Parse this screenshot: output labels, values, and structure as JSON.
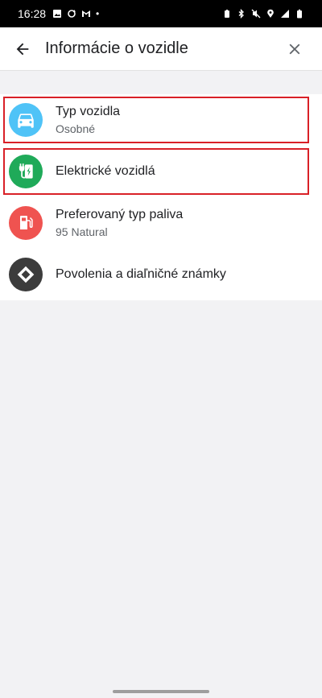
{
  "status_bar": {
    "time": "16:28",
    "dot": "•"
  },
  "app_bar": {
    "title": "Informácie o vozidle",
    "back_icon": "arrow-left-icon",
    "close_icon": "close-icon"
  },
  "items": [
    {
      "label": "Typ vozidla",
      "sublabel": "Osobné",
      "icon": "car-icon",
      "icon_color": "#4fc3f7",
      "highlighted": true
    },
    {
      "label": "Elektrické vozidlá",
      "sublabel": "",
      "icon": "ev-charger-icon",
      "icon_color": "#1faa59",
      "highlighted": true
    },
    {
      "label": "Preferovaný typ paliva",
      "sublabel": "95 Natural",
      "icon": "fuel-pump-icon",
      "icon_color": "#ef5350",
      "highlighted": false
    },
    {
      "label": "Povolenia a diaľničné známky",
      "sublabel": "",
      "icon": "road-sign-icon",
      "icon_color": "#3c3c3c",
      "highlighted": false
    }
  ],
  "colors": {
    "highlight_border": "#d92027",
    "background": "#f2f2f4"
  }
}
